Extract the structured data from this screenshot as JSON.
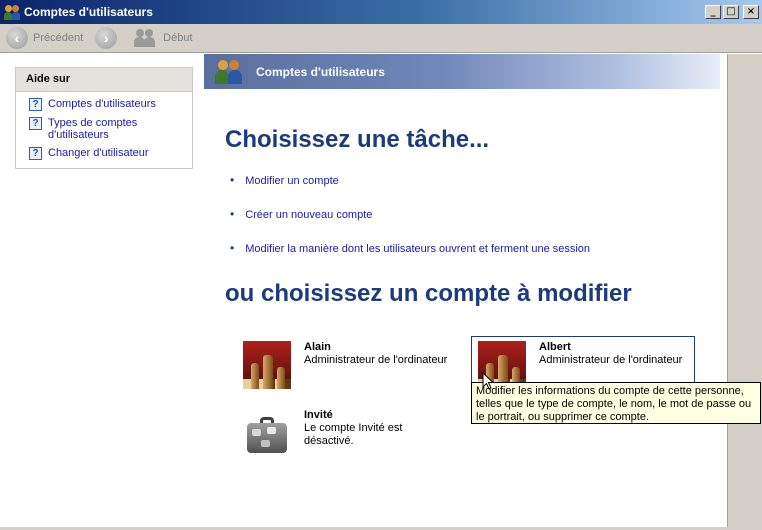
{
  "window": {
    "title": "Comptes d'utilisateurs",
    "buttons": {
      "minimize": "_",
      "maximize": "□",
      "close": "×"
    }
  },
  "toolbar": {
    "back_label": "Précédent",
    "home_label": "Début"
  },
  "help": {
    "header": "Aide sur",
    "items": [
      {
        "label": "Comptes d'utilisateurs",
        "icon": "help-question-icon"
      },
      {
        "label": "Types de comptes d'utilisateurs",
        "icon": "help-question-icon"
      },
      {
        "label": "Changer d'utilisateur",
        "icon": "help-question-icon"
      }
    ]
  },
  "banner": {
    "title": "Comptes d'utilisateurs"
  },
  "main": {
    "task_heading": "Choisissez une tâche...",
    "tasks": [
      {
        "label": "Modifier un compte"
      },
      {
        "label": "Créer un nouveau compte"
      },
      {
        "label": "Modifier la manière dont les utilisateurs ouvrent et ferment une session"
      }
    ],
    "account_heading": "ou choisissez un compte à modifier",
    "accounts": [
      {
        "name": "Alain",
        "description": "Administrateur de l'ordinateur",
        "picture": "chess-picture"
      },
      {
        "name": "Albert",
        "description": "Administrateur de l'ordinateur",
        "picture": "chess-picture"
      },
      {
        "name": "Invité",
        "description": "Le compte Invité est désactivé.",
        "picture": "suitcase-picture"
      }
    ]
  },
  "tooltip": {
    "text": "Modifier les informations du compte de cette personne, telles que le type de compte, le nom, le mot de passe ou le portrait, ou supprimer ce compte."
  },
  "colors": {
    "heading": "#1c3a7e",
    "link": "#1a1aa6",
    "tooltip_bg": "#ffffe1"
  }
}
